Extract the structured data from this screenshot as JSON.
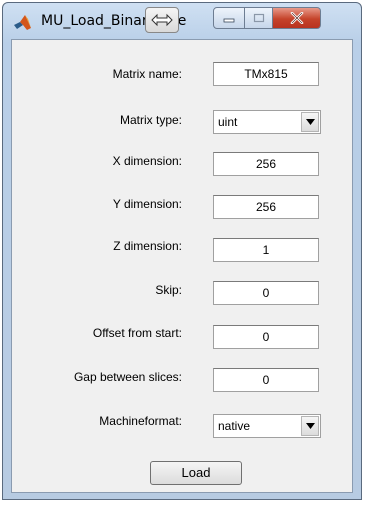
{
  "window": {
    "title": "MU_Load_Binary_File"
  },
  "form": {
    "matrix_name": {
      "label": "Matrix name:",
      "value": "TMx815"
    },
    "matrix_type": {
      "label": "Matrix type:",
      "value": "uint"
    },
    "x_dimension": {
      "label": "X dimension:",
      "value": "256"
    },
    "y_dimension": {
      "label": "Y dimension:",
      "value": "256"
    },
    "z_dimension": {
      "label": "Z dimension:",
      "value": "1"
    },
    "skip": {
      "label": "Skip:",
      "value": "0"
    },
    "offset_from_start": {
      "label": "Offset from start:",
      "value": "0"
    },
    "gap_between_slices": {
      "label": "Gap between slices:",
      "value": "0"
    },
    "machineformat": {
      "label": "Machineformat:",
      "value": "native"
    }
  },
  "actions": {
    "load_label": "Load"
  },
  "icons": {
    "app": "matlab-logo-icon",
    "cursor": "move-cursor-icon",
    "minimize": "minimize-icon",
    "maximize": "maximize-icon",
    "close": "close-icon",
    "dropdown": "chevron-down-icon"
  },
  "colors": {
    "title_bar": "#b9cfe8",
    "client_background": "#f0f0f0",
    "close_button": "#c5432b"
  }
}
